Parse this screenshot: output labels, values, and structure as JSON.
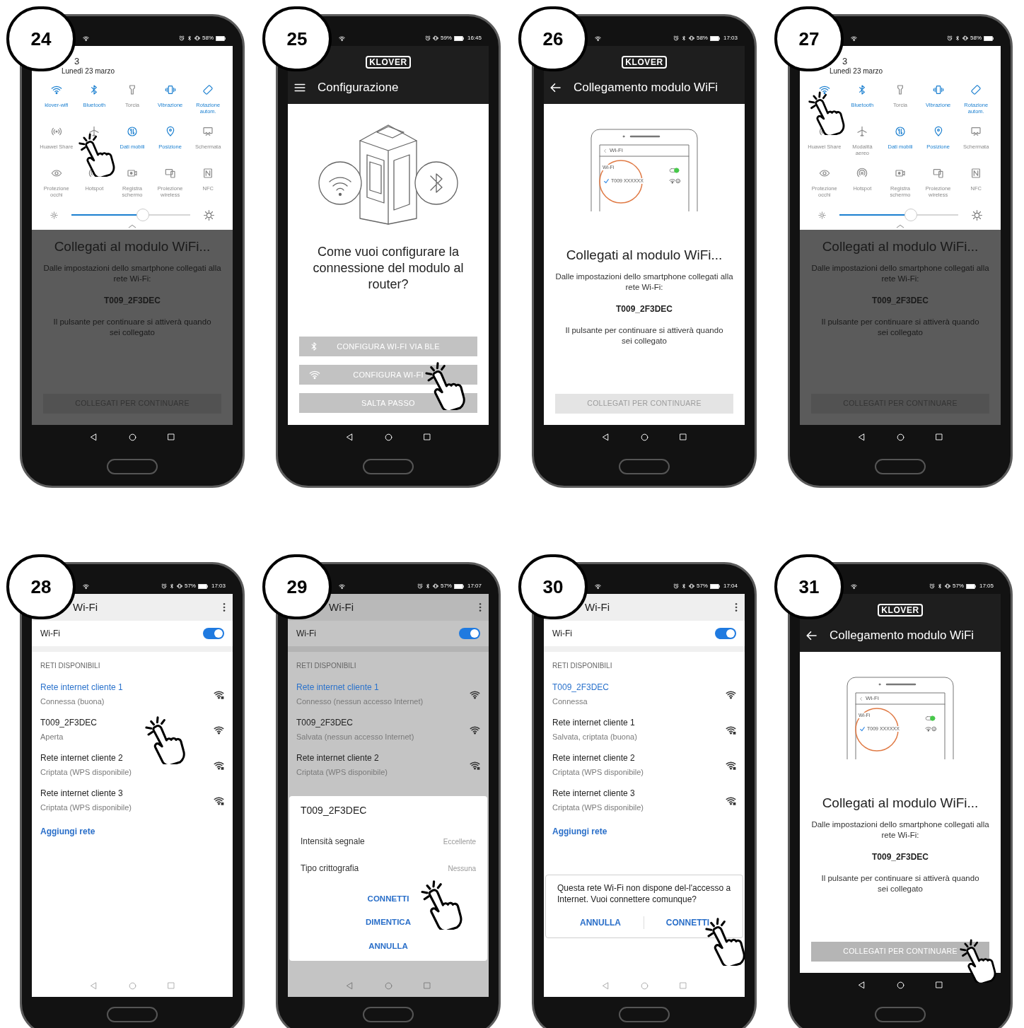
{
  "steps": [
    {
      "number": "24",
      "status": {
        "bluetooth": true,
        "battery": "58%"
      },
      "screen": {
        "kind": "quick_settings",
        "panel": {
          "time": "3",
          "date": "Lunedì 23 marzo",
          "tiles": [
            {
              "label": "klover-wifi",
              "on": true,
              "tapped": false
            },
            {
              "label": "Bluetooth",
              "on": true,
              "tapped": false
            },
            {
              "label": "Torcia",
              "on": false,
              "tapped": false
            },
            {
              "label": "Vibrazione",
              "on": true,
              "tapped": false
            },
            {
              "label": "Rotazione autom.",
              "on": true,
              "tapped": false
            },
            {
              "label": "Huawei Share",
              "on": false,
              "tapped": false
            },
            {
              "on": false,
              "tapped": true
            },
            {
              "label": "Dati mobili",
              "on": true,
              "tapped": false
            },
            {
              "label": "Posizione",
              "on": true,
              "tapped": false
            },
            {
              "label": "Schermata",
              "on": false,
              "tapped": false
            },
            {
              "label": "Protezione occhi",
              "on": false,
              "tapped": false
            },
            {
              "label": "Hotspot",
              "on": false,
              "tapped": false
            },
            {
              "label": "Registra schermo",
              "on": false,
              "tapped": false
            },
            {
              "label": "Proiezione wireless",
              "on": false,
              "tapped": false
            },
            {
              "label": "NFC",
              "on": false,
              "tapped": false
            }
          ],
          "brightness": {
            "level": 0.6
          }
        },
        "body": {
          "title": "Collegati al modulo WiFi...",
          "text": "Dalle impostazioni dello smartphone collegati alla rete Wi-Fi:",
          "network": "T009_2F3DEC",
          "note": "Il pulsante per continuare si attiverà quando sei collegato",
          "button": {
            "label": "COLLEGATI PER CONTINUARE",
            "enabled": false,
            "tapped": false
          }
        }
      }
    },
    {
      "number": "25",
      "status": {
        "bluetooth": false,
        "battery": "59%",
        "time": "16:45"
      },
      "screen": {
        "kind": "config",
        "logo": "KLOVER",
        "title": "Configurazione",
        "question": "Come vuoi configurare la connessione del modulo al router?",
        "buttons": [
          {
            "label": "CONFIGURA WI-FI VIA BLE",
            "tapped": false
          },
          {
            "label": "CONFIGURA WI-FI",
            "tapped": true
          },
          {
            "label": "SALTA PASSO",
            "tapped": false
          }
        ]
      }
    },
    {
      "number": "26",
      "status": {
        "bluetooth": true,
        "battery": "58%",
        "time": "17:03"
      },
      "screen": {
        "kind": "connect",
        "logo": "KLOVER",
        "title": "Collegamento modulo WiFi",
        "illustration": {
          "header": "Wi-Fi",
          "label": "Wi-Fi",
          "network": "T009 XXXXXX"
        },
        "body": {
          "title": "Collegati al modulo WiFi...",
          "text": "Dalle impostazioni dello smartphone collegati alla rete Wi-Fi:",
          "network": "T009_2F3DEC",
          "note": "Il pulsante per continuare si attiverà quando sei collegato",
          "button": {
            "label": "COLLEGATI PER CONTINUARE",
            "enabled": false,
            "tapped": false
          }
        }
      }
    },
    {
      "number": "27",
      "status": {
        "bluetooth": true,
        "battery": "58%"
      },
      "screen": {
        "kind": "quick_settings",
        "panel": {
          "time": "3",
          "date": "Lunedì 23 marzo",
          "tiles": [
            {
              "on": true,
              "tapped": true
            },
            {
              "label": "Bluetooth",
              "on": true,
              "tapped": false
            },
            {
              "label": "Torcia",
              "on": false,
              "tapped": false
            },
            {
              "label": "Vibrazione",
              "on": true,
              "tapped": false
            },
            {
              "label": "Rotazione autom.",
              "on": true,
              "tapped": false
            },
            {
              "label": "Huawei Share",
              "on": false,
              "tapped": false
            },
            {
              "label": "Modalità aereo",
              "on": false,
              "tapped": false
            },
            {
              "label": "Dati mobili",
              "on": true,
              "tapped": false
            },
            {
              "label": "Posizione",
              "on": true,
              "tapped": false
            },
            {
              "label": "Schermata",
              "on": false,
              "tapped": false
            },
            {
              "label": "Protezione occhi",
              "on": false,
              "tapped": false
            },
            {
              "label": "Hotspot",
              "on": false,
              "tapped": false
            },
            {
              "label": "Registra schermo",
              "on": false,
              "tapped": false
            },
            {
              "label": "Proiezione wireless",
              "on": false,
              "tapped": false
            },
            {
              "label": "NFC",
              "on": false,
              "tapped": false
            }
          ],
          "brightness": {
            "level": 0.6
          }
        },
        "body": {
          "title": "Collegati al modulo WiFi...",
          "text": "Dalle impostazioni dello smartphone collegati alla rete Wi-Fi:",
          "network": "T009_2F3DEC",
          "note": "Il pulsante per continuare si attiverà quando sei collegato",
          "button": {
            "label": "COLLEGATI PER CONTINUARE",
            "enabled": false,
            "tapped": false
          }
        }
      }
    },
    {
      "number": "28",
      "status": {
        "bluetooth": true,
        "battery": "57%",
        "time": "17:03"
      },
      "screen": {
        "kind": "wifi_list",
        "dimmed": false,
        "title": "Wi-Fi",
        "switch": {
          "label": "Wi-Fi",
          "on": true
        },
        "section": "RETI DISPONIBILI",
        "networks": [
          {
            "name": "Rete internet cliente 1",
            "status": "Connessa (buona)",
            "connected": true,
            "locked": true,
            "tapped": false
          },
          {
            "name": "T009_2F3DEC",
            "status": "Aperta",
            "connected": false,
            "locked": false,
            "tapped": true
          },
          {
            "name": "Rete internet cliente 2",
            "status": "Criptata (WPS disponibile)",
            "connected": false,
            "locked": true,
            "tapped": false
          },
          {
            "name": "Rete internet cliente 3",
            "status": "Criptata (WPS disponibile)",
            "connected": false,
            "locked": true,
            "tapped": false
          }
        ],
        "add": "Aggiungi rete"
      }
    },
    {
      "number": "29",
      "status": {
        "bluetooth": true,
        "battery": "57%",
        "time": "17:07"
      },
      "screen": {
        "kind": "wifi_list",
        "dimmed": true,
        "title": "Wi-Fi",
        "switch": {
          "label": "Wi-Fi",
          "on": true
        },
        "section": "RETI DISPONIBILI",
        "networks": [
          {
            "name": "Rete internet cliente 1",
            "status": "Connesso (nessun accesso Internet)",
            "connected": true,
            "locked": false,
            "tapped": false
          },
          {
            "name": "T009_2F3DEC",
            "status": "Salvata (nessun accesso Internet)",
            "connected": false,
            "locked": false,
            "tapped": false
          },
          {
            "name": "Rete internet cliente 2",
            "status": "Criptata (WPS disponibile)",
            "connected": false,
            "locked": true,
            "tapped": false
          }
        ],
        "dialog": {
          "kind": "details",
          "title": "T009_2F3DEC",
          "rows": [
            {
              "label": "Intensità segnale",
              "value": "Eccellente"
            },
            {
              "label": "Tipo crittografia",
              "value": "Nessuna"
            }
          ],
          "actions": [
            {
              "label": "CONNETTI",
              "tapped": true
            },
            {
              "label": "DIMENTICA",
              "tapped": false
            },
            {
              "label": "ANNULLA",
              "tapped": false
            }
          ]
        }
      }
    },
    {
      "number": "30",
      "status": {
        "bluetooth": true,
        "battery": "57%",
        "time": "17:04"
      },
      "screen": {
        "kind": "wifi_list",
        "dimmed": false,
        "title": "Wi-Fi",
        "switch": {
          "label": "Wi-Fi",
          "on": true
        },
        "section": "RETI DISPONIBILI",
        "networks": [
          {
            "name": "T009_2F3DEC",
            "status": "Connessa",
            "connected": true,
            "locked": false,
            "tapped": false
          },
          {
            "name": "Rete internet cliente 1",
            "status": "Salvata, criptata (buona)",
            "connected": false,
            "locked": true,
            "tapped": false
          },
          {
            "name": "Rete internet cliente 2",
            "status": "Criptata (WPS disponibile)",
            "connected": false,
            "locked": true,
            "tapped": false
          },
          {
            "name": "Rete internet cliente 3",
            "status": "Criptata (WPS disponibile)",
            "connected": false,
            "locked": true,
            "tapped": false
          }
        ],
        "add": "Aggiungi rete",
        "dialog": {
          "kind": "confirm",
          "message": "Questa rete Wi-Fi non dispone del-l'accesso a Internet. Vuoi connettere comunque?",
          "actions": [
            {
              "label": "ANNULLA",
              "tapped": false
            },
            {
              "label": "CONNETTI",
              "tapped": true
            }
          ]
        }
      }
    },
    {
      "number": "31",
      "status": {
        "bluetooth": true,
        "battery": "57%",
        "time": "17:05"
      },
      "screen": {
        "kind": "connect",
        "logo": "KLOVER",
        "title": "Collegamento modulo WiFi",
        "illustration": {
          "header": "Wi-Fi",
          "label": "Wi-Fi",
          "network": "T009 XXXXXX"
        },
        "body": {
          "title": "Collegati al modulo WiFi...",
          "text": "Dalle impostazioni dello smartphone collegati alla rete Wi-Fi:",
          "network": "T009_2F3DEC",
          "note": "Il pulsante per continuare si attiverà quando sei collegato",
          "button": {
            "label": "COLLEGATI PER CONTINUARE",
            "enabled": true,
            "tapped": true
          }
        }
      }
    }
  ]
}
